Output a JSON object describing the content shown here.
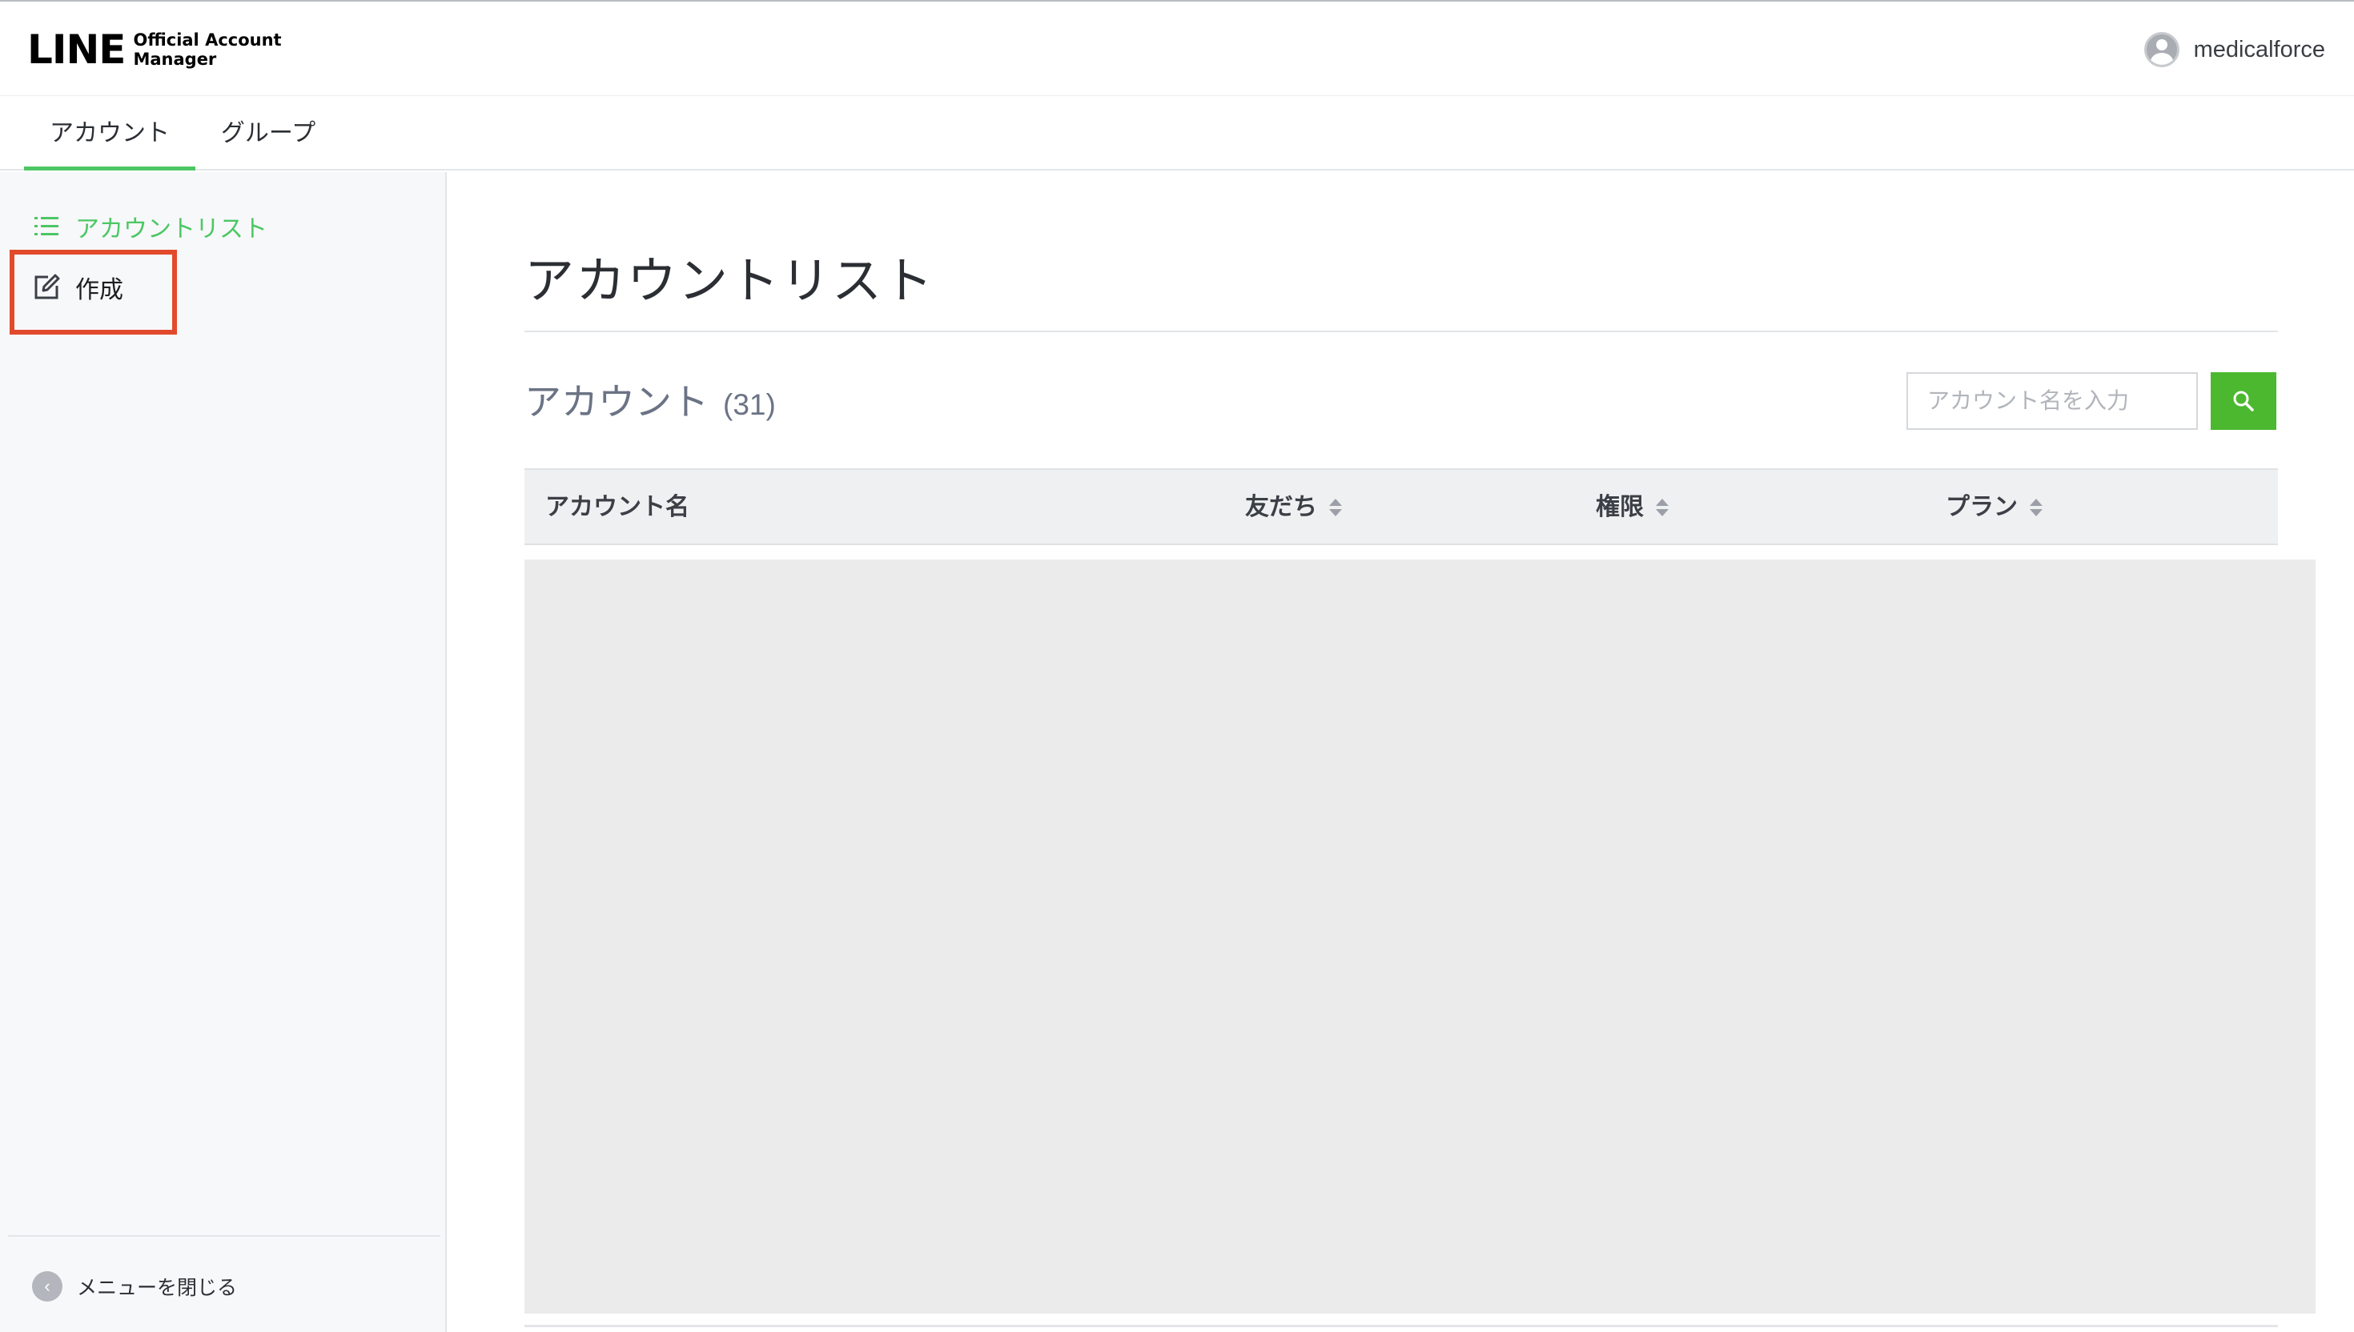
{
  "header": {
    "logo_main": "LINE",
    "logo_sub_line1": "Official Account",
    "logo_sub_line2": "Manager",
    "user_name": "medicalforce"
  },
  "tabs": [
    {
      "label": "アカウント",
      "active": true
    },
    {
      "label": "グループ",
      "active": false
    }
  ],
  "sidebar": {
    "items": [
      {
        "label": "アカウントリスト",
        "icon": "list-icon",
        "active": true
      },
      {
        "label": "作成",
        "icon": "edit-icon",
        "active": false,
        "highlighted": true
      }
    ],
    "close_label": "メニューを閉じる",
    "close_icon": "chevron-left-icon"
  },
  "main": {
    "title": "アカウントリスト",
    "section_title": "アカウント",
    "count": "(31)",
    "search": {
      "placeholder": "アカウント名を入力",
      "value": ""
    },
    "table": {
      "columns": [
        {
          "label": "アカウント名",
          "sortable": false
        },
        {
          "label": "友だち",
          "sortable": true
        },
        {
          "label": "権限",
          "sortable": true
        },
        {
          "label": "プラン",
          "sortable": true
        }
      ],
      "rows": []
    }
  },
  "colors": {
    "accent": "#4cc764",
    "search_button": "#4cb82f",
    "highlight_border": "#e24a2c",
    "sidebar_bg": "#f7f8fa"
  }
}
